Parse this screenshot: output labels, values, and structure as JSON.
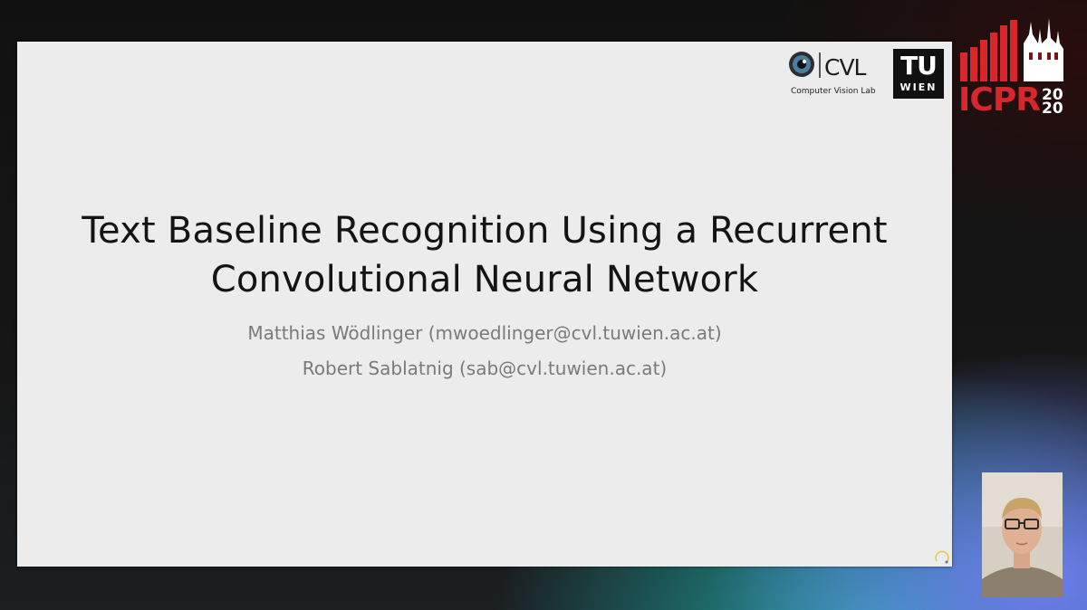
{
  "slide": {
    "title_line1": "Text Baseline Recognition Using a Recurrent",
    "title_line2": "Convolutional Neural Network",
    "author1": "Matthias Wödlinger (mwoedlinger@cvl.tuwien.ac.at)",
    "author2": "Robert Sablatnig (sab@cvl.tuwien.ac.at)"
  },
  "logos": {
    "cvl_name": "CVL",
    "cvl_subtitle": "Computer Vision Lab",
    "tu_top": "TU",
    "tu_bottom": "WIEN"
  },
  "conference": {
    "name": "ICPR",
    "year_top": "20",
    "year_bottom": "20"
  },
  "icons": [
    "cvl-eye-icon",
    "loading-cursor-icon"
  ],
  "colors": {
    "slide_bg": "#ececec",
    "title_text": "#141414",
    "author_text": "#7a7a7a",
    "icpr_red": "#d7262c"
  }
}
